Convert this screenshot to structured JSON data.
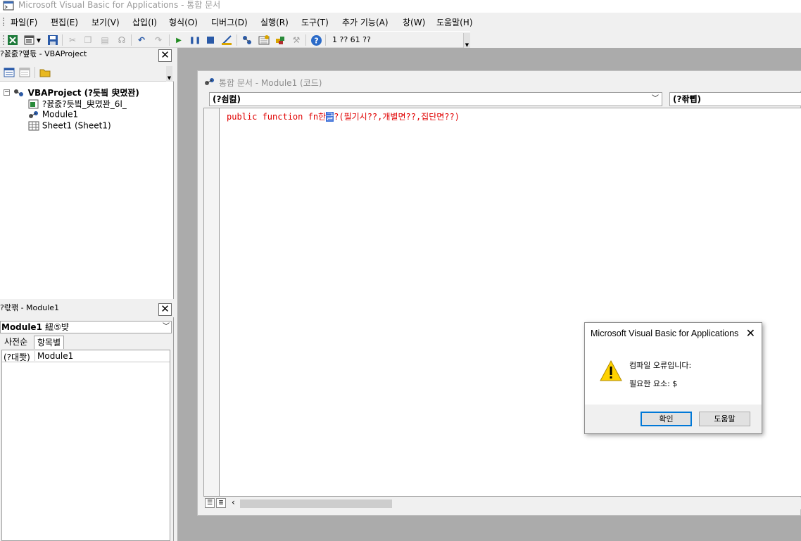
{
  "window": {
    "title": "Microsoft Visual Basic for Applications - 통합 문서"
  },
  "menu": [
    {
      "label": "파일(F)"
    },
    {
      "label": "편집(E)"
    },
    {
      "label": "보기(V)"
    },
    {
      "label": "삽입(I)"
    },
    {
      "label": "형식(O)"
    },
    {
      "label": "디버그(D)"
    },
    {
      "label": "실행(R)"
    },
    {
      "label": "도구(T)"
    },
    {
      "label": "추가 기능(A)"
    },
    {
      "label": "창(W)"
    },
    {
      "label": "도움말(H)"
    }
  ],
  "toolbar": {
    "position_text": "1 ?? 61 ??",
    "buttons": [
      "view-excel-icon",
      "insert-module-icon",
      "save-icon",
      "cut-icon",
      "copy-icon",
      "paste-icon",
      "find-icon",
      "undo-icon",
      "redo-icon",
      "run-icon",
      "break-icon",
      "reset-icon",
      "design-mode-icon",
      "project-explorer-icon",
      "properties-icon",
      "object-browser-icon",
      "toolbox-icon",
      "help-icon"
    ]
  },
  "project_panel": {
    "title": "?꾨줈?앺듃 - VBAProject",
    "tree": {
      "root": "VBAProject (?듯빀 臾몄꽌)",
      "folder": "?꾨줈?듯빀_臾몄꽌_6l_",
      "module": "Module1",
      "sheet": "Sheet1 (Sheet1)"
    }
  },
  "properties_panel": {
    "title": "?띿꽦 - Module1",
    "object_name": "Module1",
    "object_type": "紐⑤뱢",
    "tabs": [
      {
        "label": "사전순"
      },
      {
        "label": "항목별"
      }
    ],
    "row": {
      "key": "(?대쫫)",
      "value": "Module1"
    }
  },
  "code_window": {
    "title": "통합 문서 - Module1 (코드)",
    "object_combo": "(?쇰컲)",
    "proc_combo": "(?좎뼵)",
    "code": {
      "before": "public function fn한",
      "selected": "글",
      "after": "?(필기시??,개별면??,집단면??)"
    }
  },
  "dialog": {
    "title": "Microsoft Visual Basic for Applications",
    "message_line1": "컴파일 오류입니다:",
    "message_line2": "필요한 요소: $",
    "ok_label": "확인",
    "help_label": "도움말"
  },
  "colors": {
    "code_text": "#e00000",
    "selection": "#3a6ed8",
    "mdi_background": "#ababab",
    "dialog_primary_border": "#0078d7"
  }
}
